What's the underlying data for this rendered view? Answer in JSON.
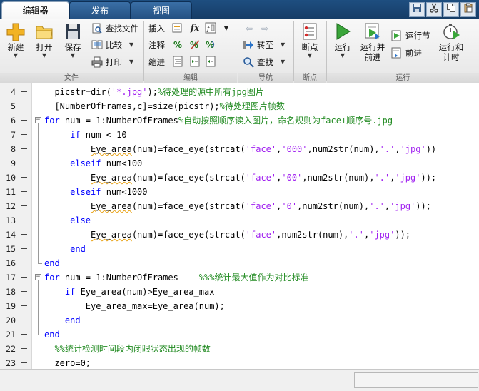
{
  "tabs": [
    {
      "label": "编辑器",
      "active": true
    },
    {
      "label": "发布",
      "active": false
    },
    {
      "label": "视图",
      "active": false
    }
  ],
  "quick_access": [
    "save-icon",
    "cut-icon",
    "copy-icon",
    "paste-icon"
  ],
  "ribbon": {
    "file": {
      "group_label": "文件",
      "new_label": "新建",
      "open_label": "打开",
      "save_label": "保存",
      "find_files_label": "查找文件",
      "compare_label": "比较",
      "print_label": "打印"
    },
    "edit": {
      "group_label": "编辑",
      "insert_label": "插入",
      "comment_label": "注释",
      "indent_label": "缩进",
      "fx_label": "fx",
      "percent_label": "%"
    },
    "navigate": {
      "group_label": "导航",
      "goto_label": "转至",
      "find_label": "查找"
    },
    "breakpoints": {
      "group_label": "断点",
      "breakpoints_label": "断点"
    },
    "run": {
      "group_label": "运行",
      "run_label": "运行",
      "run_advance_label_1": "运行并",
      "run_advance_label_2": "前进",
      "run_section_label": "运行节",
      "advance_label": "前进",
      "run_time_label_1": "运行和",
      "run_time_label_2": "计时"
    }
  },
  "editor": {
    "lines": [
      {
        "n": "4",
        "segs": [
          [
            "t",
            "  picstr=dir("
          ],
          [
            "s",
            "'*.jpg'"
          ],
          [
            "t",
            ");"
          ],
          [
            "c",
            "%待处理的源中所有jpg图片"
          ]
        ]
      },
      {
        "n": "5",
        "segs": [
          [
            "t",
            "  [NumberOfFrames,c]=size(picstr);"
          ],
          [
            "c",
            "%待处理图片帧数"
          ]
        ]
      },
      {
        "n": "6",
        "fold": "start",
        "segs": [
          [
            "k",
            "for"
          ],
          [
            "t",
            " num = 1:NumberOfFrames"
          ],
          [
            "c",
            "%自动按照顺序读入图片，命名规则为face+顺序号.jpg"
          ]
        ]
      },
      {
        "n": "7",
        "segs": [
          [
            "t",
            "     "
          ],
          [
            "k",
            "if"
          ],
          [
            "t",
            " num < 10"
          ]
        ]
      },
      {
        "n": "8",
        "segs": [
          [
            "t",
            "         "
          ],
          [
            "q",
            "Eye_area"
          ],
          [
            "t",
            "(num)=face_eye(strcat("
          ],
          [
            "s",
            "'face'"
          ],
          [
            "t",
            ","
          ],
          [
            "s",
            "'000'"
          ],
          [
            "t",
            ",num2str(num),"
          ],
          [
            "s",
            "'.'"
          ],
          [
            "t",
            ","
          ],
          [
            "s",
            "'jpg'"
          ],
          [
            "t",
            "))"
          ]
        ]
      },
      {
        "n": "9",
        "segs": [
          [
            "t",
            "     "
          ],
          [
            "k",
            "elseif"
          ],
          [
            "t",
            " num<100"
          ]
        ]
      },
      {
        "n": "10",
        "segs": [
          [
            "t",
            "         "
          ],
          [
            "q",
            "Eye_area"
          ],
          [
            "t",
            "(num)=face_eye(strcat("
          ],
          [
            "s",
            "'face'"
          ],
          [
            "t",
            ","
          ],
          [
            "s",
            "'00'"
          ],
          [
            "t",
            ",num2str(num),"
          ],
          [
            "s",
            "'.'"
          ],
          [
            "t",
            ","
          ],
          [
            "s",
            "'jpg'"
          ],
          [
            "t",
            "));"
          ]
        ]
      },
      {
        "n": "11",
        "segs": [
          [
            "t",
            "     "
          ],
          [
            "k",
            "elseif"
          ],
          [
            "t",
            " num<1000"
          ]
        ]
      },
      {
        "n": "12",
        "segs": [
          [
            "t",
            "         "
          ],
          [
            "q",
            "Eye_area"
          ],
          [
            "t",
            "(num)=face_eye(strcat("
          ],
          [
            "s",
            "'face'"
          ],
          [
            "t",
            ","
          ],
          [
            "s",
            "'0'"
          ],
          [
            "t",
            ",num2str(num),"
          ],
          [
            "s",
            "'.'"
          ],
          [
            "t",
            ","
          ],
          [
            "s",
            "'jpg'"
          ],
          [
            "t",
            "));"
          ]
        ]
      },
      {
        "n": "13",
        "segs": [
          [
            "t",
            "     "
          ],
          [
            "k",
            "else"
          ]
        ]
      },
      {
        "n": "14",
        "segs": [
          [
            "t",
            "         "
          ],
          [
            "q",
            "Eye_area"
          ],
          [
            "t",
            "(num)=face_eye(strcat("
          ],
          [
            "s",
            "'face'"
          ],
          [
            "t",
            ",num2str(num),"
          ],
          [
            "s",
            "'.'"
          ],
          [
            "t",
            ","
          ],
          [
            "s",
            "'jpg'"
          ],
          [
            "t",
            "));"
          ]
        ]
      },
      {
        "n": "15",
        "segs": [
          [
            "t",
            "     "
          ],
          [
            "k",
            "end"
          ]
        ]
      },
      {
        "n": "16",
        "fold": "end",
        "segs": [
          [
            "k",
            "end"
          ]
        ]
      },
      {
        "n": "17",
        "fold": "start",
        "segs": [
          [
            "k",
            "for"
          ],
          [
            "t",
            " num = 1:NumberOfFrames    "
          ],
          [
            "c",
            "%%%统计最大值作为对比标准"
          ]
        ]
      },
      {
        "n": "18",
        "segs": [
          [
            "t",
            "    "
          ],
          [
            "k",
            "if"
          ],
          [
            "t",
            " Eye_area(num)>Eye_area_max"
          ]
        ]
      },
      {
        "n": "19",
        "segs": [
          [
            "t",
            "        Eye_area_max=Eye_area(num);"
          ]
        ]
      },
      {
        "n": "20",
        "segs": [
          [
            "t",
            "    "
          ],
          [
            "k",
            "end"
          ]
        ]
      },
      {
        "n": "21",
        "fold": "end",
        "segs": [
          [
            "k",
            "end"
          ]
        ]
      },
      {
        "n": "22",
        "segs": [
          [
            "t",
            "  "
          ],
          [
            "c",
            "%%统计检测时间段内闭眼状态出现的帧数"
          ]
        ]
      },
      {
        "n": "23",
        "segs": [
          [
            "t",
            "  zero=0;"
          ]
        ]
      }
    ]
  },
  "colors": {
    "keyword": "#0000ff",
    "string": "#a020f0",
    "comment": "#228b22",
    "warning_underline": "#e8a317"
  }
}
